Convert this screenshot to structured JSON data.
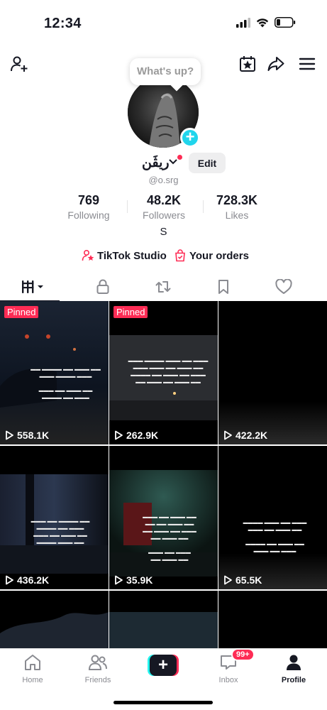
{
  "status_bar": {
    "time": "12:34"
  },
  "profile": {
    "status_bubble": "What's up?",
    "display_name": "ريڤَن",
    "edit_label": "Edit",
    "username": "@o.srg",
    "bio": "S"
  },
  "stats": [
    {
      "value": "769",
      "label": "Following"
    },
    {
      "value": "48.2K",
      "label": "Followers"
    },
    {
      "value": "728.3K",
      "label": "Likes"
    }
  ],
  "links": {
    "studio": "TikTok Studio",
    "orders": "Your orders"
  },
  "tabs": [
    "videos-tab",
    "private-tab",
    "reposts-tab",
    "favorites-tab",
    "liked-tab"
  ],
  "videos": [
    {
      "views": "558.1K",
      "pinned": "Pinned"
    },
    {
      "views": "262.9K",
      "pinned": "Pinned"
    },
    {
      "views": "422.2K"
    },
    {
      "views": "436.2K"
    },
    {
      "views": "35.9K"
    },
    {
      "views": "65.5K"
    }
  ],
  "bottom_nav": {
    "home": "Home",
    "friends": "Friends",
    "inbox": "Inbox",
    "inbox_badge": "99+",
    "profile": "Profile"
  },
  "colors": {
    "accent": "#fe2c55",
    "cyan": "#25f4ee",
    "plus": "#20d5ec"
  }
}
